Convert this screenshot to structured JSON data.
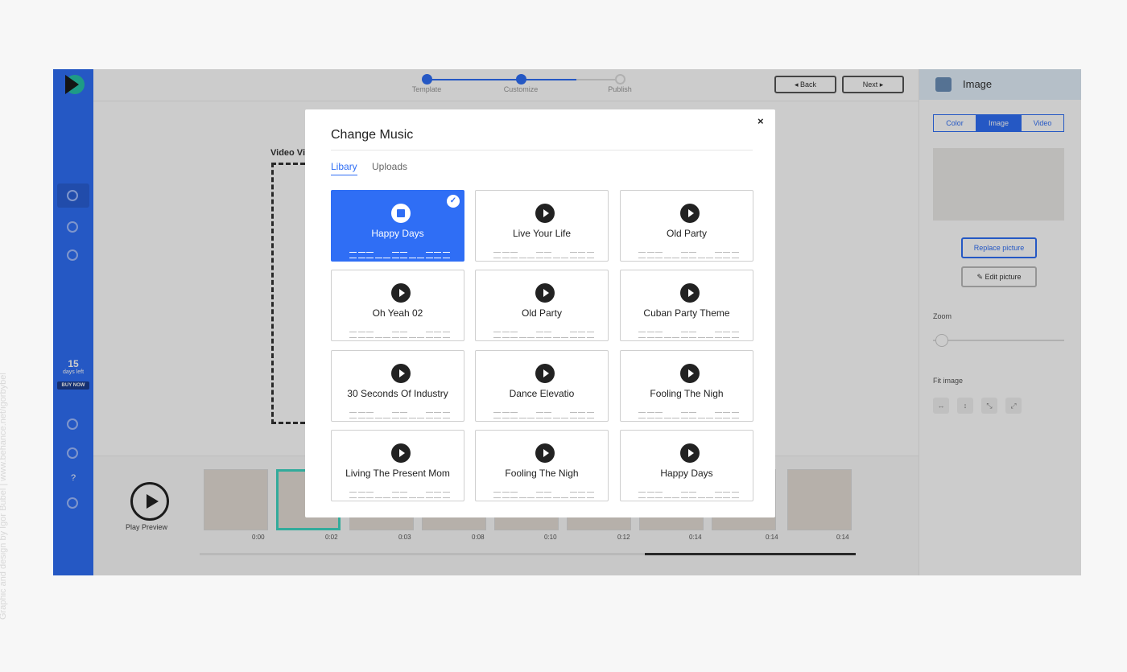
{
  "credit": "Graphic and design by Igor Bubel | www.behance.net/igorbybel",
  "stepper": {
    "steps": [
      {
        "label": "Template",
        "done": true
      },
      {
        "label": "Customize",
        "done": true
      },
      {
        "label": "Publish",
        "done": false
      }
    ],
    "back_label": "◂ Back",
    "next_label": "Next ▸"
  },
  "sidebar": {
    "days_count": "15",
    "days_label": "days left",
    "buy_now": "BUY NOW",
    "help_glyph": "?"
  },
  "canvas": {
    "title": "Video Vi"
  },
  "timeline": {
    "play_label": "Play Preview",
    "times": [
      "0:00",
      "0:02",
      "0:03",
      "0:08",
      "0:10",
      "0:12",
      "0:14",
      "0:14",
      "0:14"
    ]
  },
  "panel": {
    "title": "Image",
    "segments": [
      "Color",
      "Image",
      "Video"
    ],
    "active_segment": "Image",
    "replace_label": "Replace picture",
    "edit_label": "✎ Edit picture",
    "zoom_label": "Zoom",
    "fit_label": "Fit image",
    "fit_icons": [
      "↔",
      "↕",
      "⤡",
      "⤢"
    ]
  },
  "modal": {
    "title": "Change Music",
    "close_glyph": "×",
    "tabs": [
      "Libary",
      "Uploads"
    ],
    "active_tab": "Libary",
    "check_glyph": "✓",
    "tracks": [
      {
        "title": "Happy Days",
        "selected": true
      },
      {
        "title": "Live Your Life",
        "selected": false
      },
      {
        "title": "Old Party",
        "selected": false
      },
      {
        "title": "Oh Yeah 02",
        "selected": false
      },
      {
        "title": "Old Party",
        "selected": false
      },
      {
        "title": "Cuban Party Theme",
        "selected": false
      },
      {
        "title": "30 Seconds Of Industry",
        "selected": false
      },
      {
        "title": "Dance Elevatio",
        "selected": false
      },
      {
        "title": "Fooling The Nigh",
        "selected": false
      },
      {
        "title": "Living The Present Mom",
        "selected": false
      },
      {
        "title": "Fooling The Nigh",
        "selected": false
      },
      {
        "title": "Happy Days",
        "selected": false
      }
    ]
  },
  "colors": {
    "accent": "#2f6ef5",
    "rail": "#2f6ef5",
    "selected_thumb": "#3fd6c2"
  }
}
